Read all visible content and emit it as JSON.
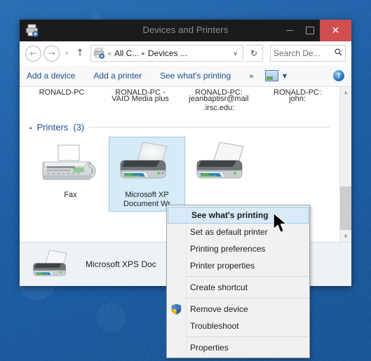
{
  "window": {
    "title": "Devices and Printers",
    "icon": "printer-icon",
    "buttons": {
      "minimize": "–",
      "maximize": "□",
      "close": "✕"
    }
  },
  "navbar": {
    "back": "←",
    "forward": "→",
    "history_caret": "▼",
    "up": "↑",
    "address_icon": "devices-printers-icon",
    "address_prefix": "«",
    "address_segments": [
      "All C...",
      "Devices ..."
    ],
    "segment_separator": "▸",
    "dropdown_caret": "∨",
    "refresh": "↻",
    "search_placeholder": "Search De...",
    "search_value": "",
    "search_icon": "🔍"
  },
  "commandbar": {
    "items": [
      "Add a device",
      "Add a printer",
      "See what's printing"
    ],
    "overflow": "»",
    "view_caret": "▼",
    "help": "?"
  },
  "content": {
    "top_row_names": [
      "RONALD-PC",
      "RONALD-PC - VAIO Media plus",
      "RONALD-PC: jeanbaptisr@mail.irsc.edu:",
      "RONALD-PC: john:"
    ],
    "group": {
      "triangle": "▴",
      "label": "Printers",
      "count": "(3)"
    },
    "printers": [
      {
        "name": "Fax",
        "icon": "fax-printer-icon",
        "selected": false
      },
      {
        "name": "Microsoft XPS Document Wr...",
        "icon": "printer-icon",
        "selected": true
      },
      {
        "name": "",
        "icon": "printer-icon",
        "selected": false
      }
    ]
  },
  "details": {
    "icon": "printer-icon",
    "name": "Microsoft XPS Doc"
  },
  "scrollbar": {
    "up": "∧",
    "down": "∨"
  },
  "context_menu": {
    "items": [
      {
        "label": "See what's printing",
        "highlighted": true,
        "shield": false,
        "separator_after": false
      },
      {
        "label": "Set as default printer",
        "highlighted": false,
        "shield": false,
        "separator_after": false
      },
      {
        "label": "Printing preferences",
        "highlighted": false,
        "shield": false,
        "separator_after": false
      },
      {
        "label": "Printer properties",
        "highlighted": false,
        "shield": false,
        "separator_after": true
      },
      {
        "label": "Create shortcut",
        "highlighted": false,
        "shield": false,
        "separator_after": true
      },
      {
        "label": "Remove device",
        "highlighted": false,
        "shield": true,
        "separator_after": false
      },
      {
        "label": "Troubleshoot",
        "highlighted": false,
        "shield": false,
        "separator_after": true
      },
      {
        "label": "Properties",
        "highlighted": false,
        "shield": false,
        "separator_after": false
      }
    ]
  },
  "colors": {
    "titlebar": "#1b1b1b",
    "close_button": "#cf4e4e",
    "accent_link": "#1d4f8c",
    "selection": "#d6eaf8",
    "desktop": "#1d5ea5"
  }
}
